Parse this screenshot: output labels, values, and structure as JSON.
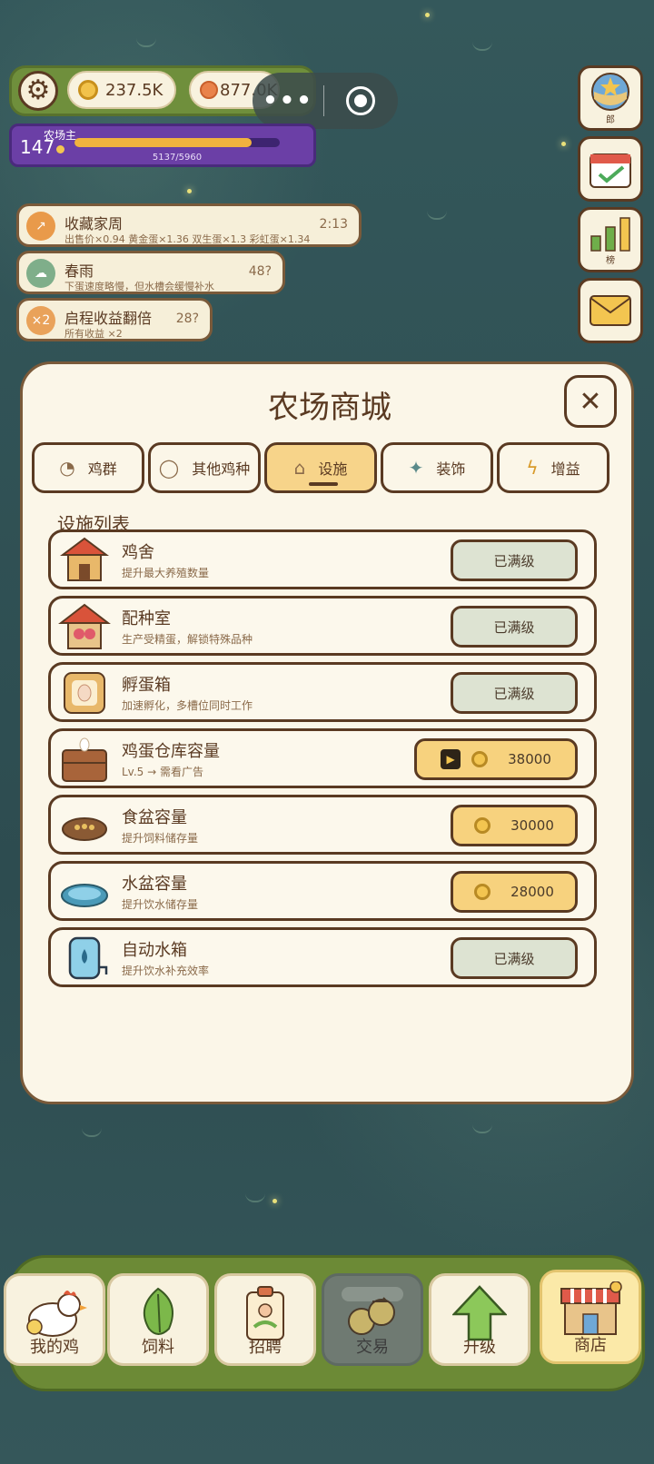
{
  "hud": {
    "coins": "237.5K",
    "gems": "877.0K",
    "level": "147",
    "level_title": "农场主",
    "xp_text": "5137/5960",
    "xp_fraction": 0.862,
    "menu_dots": "•••"
  },
  "side_buttons": [
    {
      "icon": "globe-badge-icon",
      "label": "郎"
    },
    {
      "icon": "calendar-check-icon",
      "label": ""
    },
    {
      "icon": "bar-chart-icon",
      "label": "榜"
    },
    {
      "icon": "mail-icon",
      "label": ""
    }
  ],
  "notices": [
    {
      "icon_text": "↗",
      "title": "收藏家周",
      "subtitle": "出售价×0.94 黄金蛋×1.36 双生蛋×1.3 彩虹蛋×1.34",
      "time": "2:13",
      "color": "#e99a4a"
    },
    {
      "icon_text": "☁",
      "title": "春雨",
      "subtitle": "下蛋速度略慢，但水槽会缓慢补水",
      "time": "48?",
      "color": "#7fae8a"
    },
    {
      "icon_text": "×2",
      "title": "启程收益翻倍",
      "subtitle": "所有收益 ×2",
      "time": "28?",
      "color": "#e9a25a"
    }
  ],
  "shop": {
    "title": "农场商城",
    "close": "✕",
    "tabs": [
      {
        "icon": "chick-icon",
        "label": "鸡群"
      },
      {
        "icon": "chicken-icon",
        "label": "其他鸡种"
      },
      {
        "icon": "house-icon",
        "label": "设施"
      },
      {
        "icon": "sparkle-icon",
        "label": "装饰"
      },
      {
        "icon": "lightning-icon",
        "label": "增益"
      }
    ],
    "active_tab": 2,
    "section_title": "设施列表",
    "items": [
      {
        "icon": "coop-icon",
        "title": "鸡舍",
        "subtitle": "提升最大养殖数量",
        "action": "已满级",
        "type": "maxed"
      },
      {
        "icon": "breeding-room-icon",
        "title": "配种室",
        "subtitle": "生产受精蛋，解锁特殊品种",
        "action": "已满级",
        "type": "maxed"
      },
      {
        "icon": "incubator-icon",
        "title": "孵蛋箱",
        "subtitle": "加速孵化，多槽位同时工作",
        "action": "已满级",
        "type": "maxed"
      },
      {
        "icon": "egg-storage-icon",
        "title": "鸡蛋仓库容量",
        "subtitle": "Lv.5 → 需看广告",
        "action": "38000",
        "type": "ad"
      },
      {
        "icon": "food-bowl-icon",
        "title": "食盆容量",
        "subtitle": "提升饲料储存量",
        "action": "30000",
        "type": "buy"
      },
      {
        "icon": "water-bowl-icon",
        "title": "水盆容量",
        "subtitle": "提升饮水储存量",
        "action": "28000",
        "type": "buy"
      },
      {
        "icon": "water-tank-icon",
        "title": "自动水箱",
        "subtitle": "提升饮水补充效率",
        "action": "已满级",
        "type": "maxed"
      }
    ]
  },
  "nav": [
    {
      "icon": "hen-icon",
      "label": "我的鸡"
    },
    {
      "icon": "leaf-icon",
      "label": "饲料"
    },
    {
      "icon": "badge-icon",
      "label": "招聘"
    },
    {
      "icon": "trade-icon",
      "label": "交易"
    },
    {
      "icon": "up-arrow-icon",
      "label": "升级"
    },
    {
      "icon": "shop-icon",
      "label": "商店"
    }
  ]
}
